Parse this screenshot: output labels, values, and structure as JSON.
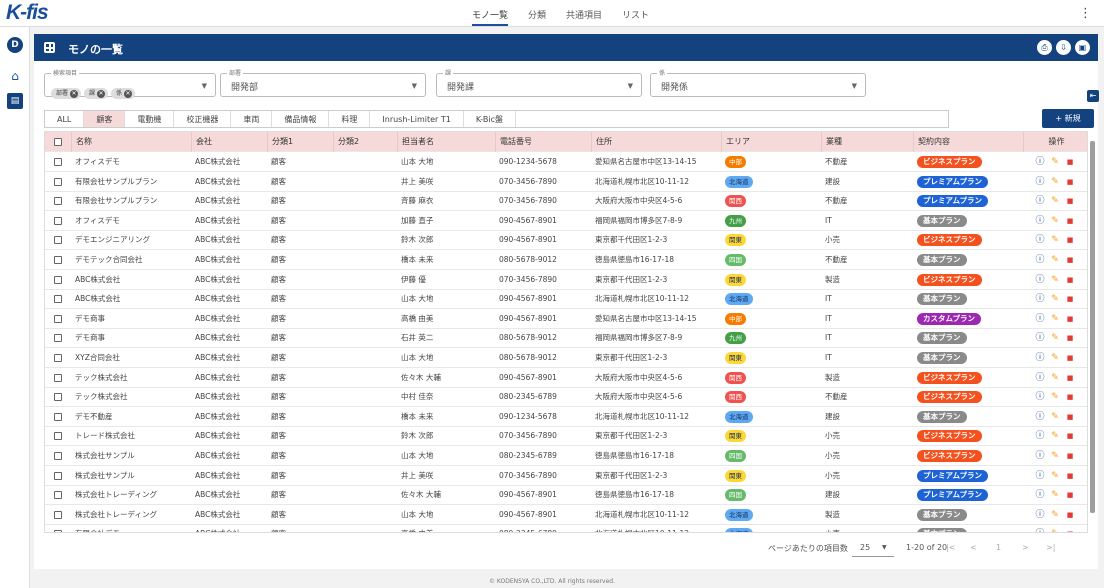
{
  "app": {
    "logo": "K-fis"
  },
  "nav": {
    "items": [
      "モノ一覧",
      "分類",
      "共通項目",
      "リスト"
    ],
    "active": 0
  },
  "page": {
    "title": "モノの一覧"
  },
  "filters": {
    "search_items": {
      "label": "検索項目",
      "chips": [
        "部署",
        "課",
        "係"
      ]
    },
    "department": {
      "label": "部署",
      "value": "開発部"
    },
    "section": {
      "label": "課",
      "value": "開発課"
    },
    "group": {
      "label": "係",
      "value": "開発係"
    }
  },
  "tabs": [
    "ALL",
    "顧客",
    "電動機",
    "校正機器",
    "車両",
    "備品情報",
    "料理",
    "Inrush-Limiter T1",
    "K-Bic盤"
  ],
  "active_tab": 1,
  "new_button": "+ 新規",
  "columns": [
    "名称",
    "会社",
    "分類1",
    "分類2",
    "担当者名",
    "電話番号",
    "住所",
    "エリア",
    "業種",
    "契約内容",
    "操作"
  ],
  "area_colors": {
    "中部": "#f57c00",
    "北海道": "#42a5f5",
    "関西": "#ef5350",
    "九州": "#43a047",
    "関東": "#fdd835",
    "四国": "#66bb6a"
  },
  "plan_colors": {
    "ビジネスプラン": "#f4511e",
    "プレミアムプラン": "#1e63d6",
    "基本プラン": "#8a8a8a",
    "カスタムプラン": "#9c27b0"
  },
  "rows": [
    {
      "name": "オフィスデモ",
      "company": "ABC株式会社",
      "cat1": "顧客",
      "cat2": "",
      "person": "山本 大地",
      "phone": "090-1234-5678",
      "address": "愛知県名古屋市中区13-14-15",
      "area": "中部",
      "industry": "不動産",
      "plan": "ビジネスプラン"
    },
    {
      "name": "有限会社サンプルプラン",
      "company": "ABC株式会社",
      "cat1": "顧客",
      "cat2": "",
      "person": "井上 美咲",
      "phone": "070-3456-7890",
      "address": "北海道札幌市北区10-11-12",
      "area": "北海道",
      "industry": "建設",
      "plan": "プレミアムプラン"
    },
    {
      "name": "有限会社サンプルプラン",
      "company": "ABC株式会社",
      "cat1": "顧客",
      "cat2": "",
      "person": "斉藤 麻衣",
      "phone": "070-3456-7890",
      "address": "大阪府大阪市中央区4-5-6",
      "area": "関西",
      "industry": "不動産",
      "plan": "プレミアムプラン"
    },
    {
      "name": "オフィスデモ",
      "company": "ABC株式会社",
      "cat1": "顧客",
      "cat2": "",
      "person": "加藤 直子",
      "phone": "090-4567-8901",
      "address": "福岡県福岡市博多区7-8-9",
      "area": "九州",
      "industry": "IT",
      "plan": "基本プラン"
    },
    {
      "name": "デモエンジニアリング",
      "company": "ABC株式会社",
      "cat1": "顧客",
      "cat2": "",
      "person": "鈴木 次郎",
      "phone": "090-4567-8901",
      "address": "東京都千代田区1-2-3",
      "area": "関東",
      "industry": "小売",
      "plan": "ビジネスプラン"
    },
    {
      "name": "デモテック合同会社",
      "company": "ABC株式会社",
      "cat1": "顧客",
      "cat2": "",
      "person": "橋本 未来",
      "phone": "080-5678-9012",
      "address": "徳島県徳島市16-17-18",
      "area": "四国",
      "industry": "不動産",
      "plan": "基本プラン"
    },
    {
      "name": "ABC株式会社",
      "company": "ABC株式会社",
      "cat1": "顧客",
      "cat2": "",
      "person": "伊藤 優",
      "phone": "070-3456-7890",
      "address": "東京都千代田区1-2-3",
      "area": "関東",
      "industry": "製造",
      "plan": "ビジネスプラン"
    },
    {
      "name": "ABC株式会社",
      "company": "ABC株式会社",
      "cat1": "顧客",
      "cat2": "",
      "person": "山本 大地",
      "phone": "090-4567-8901",
      "address": "北海道札幌市北区10-11-12",
      "area": "北海道",
      "industry": "IT",
      "plan": "基本プラン"
    },
    {
      "name": "デモ商事",
      "company": "ABC株式会社",
      "cat1": "顧客",
      "cat2": "",
      "person": "高橋 由美",
      "phone": "090-4567-8901",
      "address": "愛知県名古屋市中区13-14-15",
      "area": "中部",
      "industry": "IT",
      "plan": "カスタムプラン"
    },
    {
      "name": "デモ商事",
      "company": "ABC株式会社",
      "cat1": "顧客",
      "cat2": "",
      "person": "石井 英二",
      "phone": "080-5678-9012",
      "address": "福岡県福岡市博多区7-8-9",
      "area": "九州",
      "industry": "IT",
      "plan": "基本プラン"
    },
    {
      "name": "XYZ合同会社",
      "company": "ABC株式会社",
      "cat1": "顧客",
      "cat2": "",
      "person": "山本 大地",
      "phone": "080-5678-9012",
      "address": "東京都千代田区1-2-3",
      "area": "関東",
      "industry": "IT",
      "plan": "基本プラン"
    },
    {
      "name": "テック株式会社",
      "company": "ABC株式会社",
      "cat1": "顧客",
      "cat2": "",
      "person": "佐々木 大輔",
      "phone": "090-4567-8901",
      "address": "大阪府大阪市中央区4-5-6",
      "area": "関西",
      "industry": "製造",
      "plan": "ビジネスプラン"
    },
    {
      "name": "テック株式会社",
      "company": "ABC株式会社",
      "cat1": "顧客",
      "cat2": "",
      "person": "中村 佳奈",
      "phone": "080-2345-6789",
      "address": "大阪府大阪市中央区4-5-6",
      "area": "関西",
      "industry": "不動産",
      "plan": "ビジネスプラン"
    },
    {
      "name": "デモ不動産",
      "company": "ABC株式会社",
      "cat1": "顧客",
      "cat2": "",
      "person": "橋本 未来",
      "phone": "090-1234-5678",
      "address": "北海道札幌市北区10-11-12",
      "area": "北海道",
      "industry": "建設",
      "plan": "基本プラン"
    },
    {
      "name": "トレード株式会社",
      "company": "ABC株式会社",
      "cat1": "顧客",
      "cat2": "",
      "person": "鈴木 次郎",
      "phone": "070-3456-7890",
      "address": "東京都千代田区1-2-3",
      "area": "関東",
      "industry": "小売",
      "plan": "ビジネスプラン"
    },
    {
      "name": "株式会社サンプル",
      "company": "ABC株式会社",
      "cat1": "顧客",
      "cat2": "",
      "person": "山本 大地",
      "phone": "080-2345-6789",
      "address": "徳島県徳島市16-17-18",
      "area": "四国",
      "industry": "小売",
      "plan": "ビジネスプラン"
    },
    {
      "name": "株式会社サンプル",
      "company": "ABC株式会社",
      "cat1": "顧客",
      "cat2": "",
      "person": "井上 美咲",
      "phone": "070-3456-7890",
      "address": "東京都千代田区1-2-3",
      "area": "関東",
      "industry": "小売",
      "plan": "プレミアムプラン"
    },
    {
      "name": "株式会社トレーディング",
      "company": "ABC株式会社",
      "cat1": "顧客",
      "cat2": "",
      "person": "佐々木 大輔",
      "phone": "090-4567-8901",
      "address": "徳島県徳島市16-17-18",
      "area": "四国",
      "industry": "建設",
      "plan": "プレミアムプラン"
    },
    {
      "name": "株式会社トレーディング",
      "company": "ABC株式会社",
      "cat1": "顧客",
      "cat2": "",
      "person": "山本 大地",
      "phone": "090-4567-8901",
      "address": "北海道札幌市北区10-11-12",
      "area": "北海道",
      "industry": "製造",
      "plan": "基本プラン"
    },
    {
      "name": "有限会社デモ",
      "company": "ABC株式会社",
      "cat1": "顧客",
      "cat2": "",
      "person": "高橋 由美",
      "phone": "080-2345-6789",
      "address": "北海道札幌市北区10-11-12",
      "area": "北海道",
      "industry": "小売",
      "plan": "基本プラン"
    }
  ],
  "pager": {
    "per_page_label": "ページあたりの項目数",
    "per_page": "25",
    "range": "1-20 of 20"
  },
  "footer": "© KODENSYA CO.,LTD. All rights reserved."
}
